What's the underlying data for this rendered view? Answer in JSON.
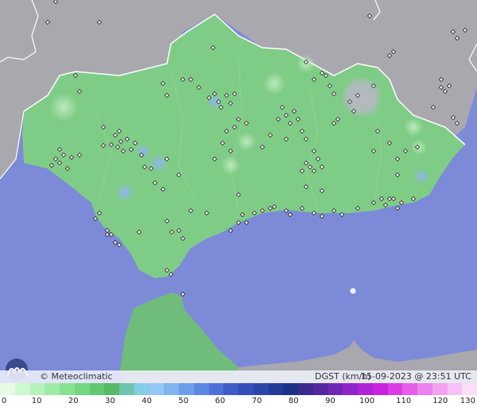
{
  "footer": {
    "credit": "© Meteoclimatic",
    "legend_title": "DGST (km/h)",
    "timestamp": "15-09-2023 @ 23:51 UTC"
  },
  "legend": {
    "ticks": [
      "0",
      "10",
      "20",
      "30",
      "40",
      "50",
      "60",
      "70",
      "80",
      "90",
      "100",
      "110",
      "120",
      "130"
    ],
    "colors": [
      "#e6fbe6",
      "#cff7d2",
      "#b6f2bd",
      "#9eeba7",
      "#86e292",
      "#72d77f",
      "#62c86f",
      "#58ba66",
      "#6fc4ae",
      "#86cde6",
      "#92c8f4",
      "#7fb4f0",
      "#6d9ee9",
      "#5b87e0",
      "#4d71d6",
      "#3f5dc8",
      "#3450b8",
      "#2b45a8",
      "#233a98",
      "#1d3088",
      "#3a2a8e",
      "#5527a0",
      "#7226b4",
      "#8f24c8",
      "#ad22d6",
      "#c824df",
      "#dc3ce4",
      "#e65ee9",
      "#ed80ee",
      "#f3a2f2",
      "#f7c0f6",
      "#fbddfa"
    ]
  },
  "map": {
    "colors": {
      "sea": "#7d8ad8",
      "land_outside": "#a8a8ae",
      "region_fill": "#7fcc86",
      "morocco_fill": "#6fbc7b",
      "border": "#ffffff"
    }
  }
}
